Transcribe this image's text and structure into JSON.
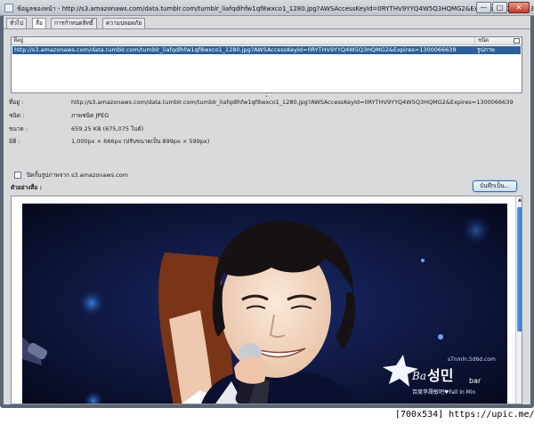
{
  "window": {
    "title": "ข้อมูลของหน้า - http://s3.amazonaws.com/data.tumblr.com/tumblr_liafqdlhfw1qf8wxco1_1280.jpg?AWSAccessKeyId=0RYTHV9YYQ4W5Q3HQMG2&Expires=1300066639",
    "min_glyph": "—",
    "max_glyph": "□",
    "close_glyph": "✕"
  },
  "tabs": [
    {
      "label": "ทั่วไป"
    },
    {
      "label": "สื่อ"
    },
    {
      "label": "การกำหนดสิทธิ์"
    },
    {
      "label": "ความปลอดภัย"
    }
  ],
  "media_list": {
    "header_address": "ที่อยู่",
    "header_type": "ชนิด",
    "rows": [
      {
        "address": "http://s3.amazonaws.com/data.tumblr.com/tumblr_liafqdlhfw1qf8wxco1_1280.jpg?AWSAccessKeyId=0RYTHV9YYQ4W5Q3HQMG2&Expires=1300066639",
        "type": "รูปภาพ"
      }
    ]
  },
  "properties": [
    {
      "key": "ที่อยู่ :",
      "value": "http://s3.amazonaws.com/data.tumblr.com/tumblr_liafqdlhfw1qf8wxco1_1280.jpg?AWSAccessKeyId=0RYTHV9YYQ4W5Q3HQMG2&Expires=1300066639"
    },
    {
      "key": "ชนิด :",
      "value": "ภาพชนิด JPEG"
    },
    {
      "key": "ขนาด :",
      "value": "659.25 KB (675,075 ไบต์)"
    },
    {
      "key": "มิติ :",
      "value": "1,000px × 666px (ปรับขนาดเป็น 899px × 599px)"
    }
  ],
  "block_images": {
    "label": "ปิดกั้นรูปภาพจาก s3.amazonaws.com",
    "checked": false
  },
  "preview": {
    "label": "ตัวอย่างสื่อ :",
    "save_button": "บันทึกเป็น...",
    "watermark_url": "sTnmln.5d6d.com",
    "watermark_logo": "성민",
    "watermark_sub": "bar",
    "watermark_line2": "百度李晟敏吧♥Fall In Min"
  },
  "caption": {
    "dims": "[700x534]",
    "site": "https://upic.me/"
  },
  "colors": {
    "frame": "#5a6676",
    "selection": "#2d5f9a",
    "scroll_thumb": "#2f6fc0"
  }
}
